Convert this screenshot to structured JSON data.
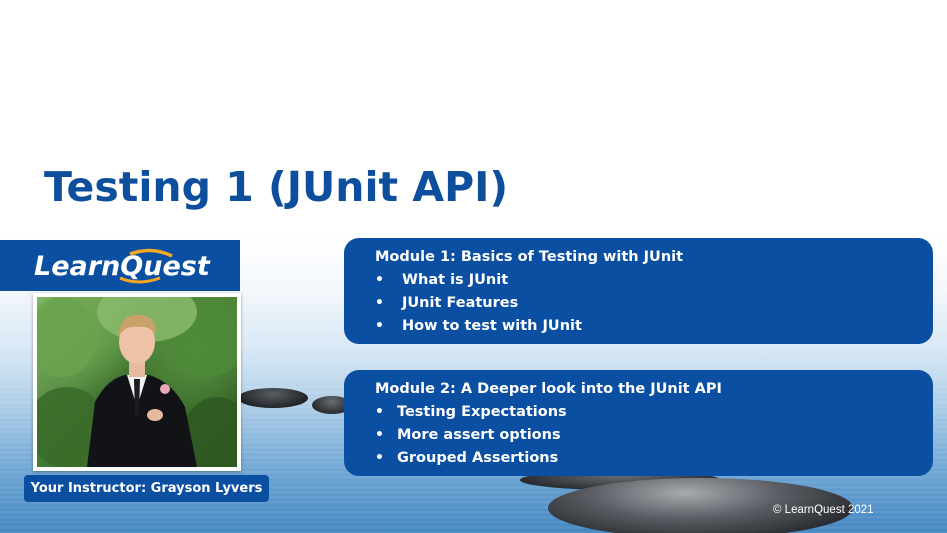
{
  "slide": {
    "title": "Testing 1 (JUnit API)",
    "logo_text": "LearnQuest",
    "instructor_caption": "Your Instructor: Grayson Lyvers",
    "copyright": "© LearnQuest 2021"
  },
  "modules": [
    {
      "heading": "Module 1: Basics of Testing with JUnit",
      "items": [
        "What is JUnit",
        "JUnit Features",
        "How to test with JUnit"
      ]
    },
    {
      "heading": "Module 2: A Deeper look into the JUnit API",
      "items": [
        "Testing Expectations",
        "More assert options",
        "Grouped Assertions"
      ]
    }
  ],
  "bullet_glyph": "•",
  "colors": {
    "brand_blue": "#0b4fa2",
    "title_blue": "#0d4f9c",
    "accent_orange": "#f5a623"
  },
  "icons": {
    "logo": "learnquest-logo",
    "photo": "instructor-photo"
  }
}
